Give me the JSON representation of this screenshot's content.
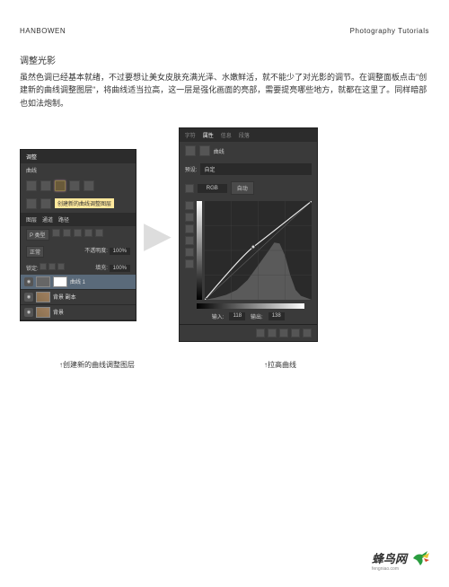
{
  "header": {
    "left": "HANBOWEN",
    "right": "Photography Tutorials"
  },
  "section_title": "调整光影",
  "body_text": "虽然色调已经基本就绪，不过要想让美女皮肤充满光泽、水嫩鲜活，就不能少了对光影的调节。在调整面板点击\"创建新的曲线调整图层\"，将曲线适当拉高，这一层是强化画面的亮部，需要提亮哪些地方，就都在这里了。同样暗部也如法炮制。",
  "panel_left": {
    "title": "调整",
    "subtitle": "曲线",
    "tooltip": "创建新的曲线调整图层",
    "tabs": [
      "图层",
      "通道",
      "路径"
    ],
    "kind_label": "P 类型",
    "opacity_label": "不透明度:",
    "opacity_value": "100%",
    "lock_label": "锁定:",
    "fill_label": "填充:",
    "fill_value": "100%",
    "normal_label": "正常",
    "layers": [
      {
        "name": "曲线 1",
        "selected": true,
        "type": "adj"
      },
      {
        "name": "背景 副本",
        "selected": false,
        "type": "img"
      },
      {
        "name": "背景",
        "selected": false,
        "type": "img"
      }
    ]
  },
  "panel_right": {
    "tabs": [
      "字符",
      "属性",
      "信息",
      "段落"
    ],
    "active_tab": "属性",
    "type_label": "曲线",
    "preset_label": "预设:",
    "preset_value": "自定",
    "channel": "RGB",
    "auto_label": "自动",
    "input_label": "输入:",
    "input_value": "118",
    "output_label": "输出:",
    "output_value": "138"
  },
  "captions": {
    "left": "↑创建新的曲线调整图层",
    "right": "↑拉高曲线"
  },
  "logo": {
    "text": "蜂鸟网",
    "sub": "fengniao.com"
  },
  "chart_data": {
    "type": "line",
    "title": "Curves Adjustment",
    "xlabel": "Input",
    "ylabel": "Output",
    "xlim": [
      0,
      255
    ],
    "ylim": [
      0,
      255
    ],
    "series": [
      {
        "name": "RGB curve",
        "values": [
          [
            0,
            0
          ],
          [
            118,
            138
          ],
          [
            255,
            255
          ]
        ]
      }
    ],
    "histogram": {
      "peak_input": 180,
      "peak_height": 0.95
    }
  }
}
